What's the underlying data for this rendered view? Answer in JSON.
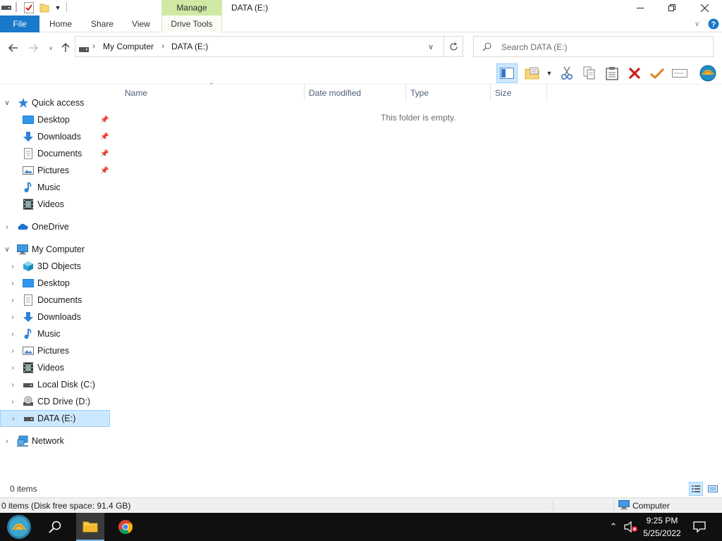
{
  "window": {
    "title": "DATA (E:)",
    "context_tab": "Manage",
    "controls": [
      "minimize",
      "restore",
      "close"
    ]
  },
  "ribbon": {
    "tabs": [
      {
        "label": "File"
      },
      {
        "label": "Home"
      },
      {
        "label": "Share"
      },
      {
        "label": "View"
      },
      {
        "label": "Drive Tools"
      }
    ]
  },
  "address": {
    "crumbs": [
      "My Computer",
      "DATA (E:)"
    ],
    "search_placeholder": "Search DATA (E:)"
  },
  "nav": {
    "quick_access": "Quick access",
    "quick_items": [
      {
        "label": "Desktop",
        "icon": "desktop-icon",
        "pinned": true
      },
      {
        "label": "Downloads",
        "icon": "downloads-icon",
        "pinned": true
      },
      {
        "label": "Documents",
        "icon": "documents-icon",
        "pinned": true
      },
      {
        "label": "Pictures",
        "icon": "pictures-icon",
        "pinned": true
      },
      {
        "label": "Music",
        "icon": "music-icon",
        "pinned": false
      },
      {
        "label": "Videos",
        "icon": "videos-icon",
        "pinned": false
      }
    ],
    "onedrive": "OneDrive",
    "my_computer": "My Computer",
    "computer_items": [
      {
        "label": "3D Objects",
        "icon": "3d-objects-icon"
      },
      {
        "label": "Desktop",
        "icon": "desktop-icon"
      },
      {
        "label": "Documents",
        "icon": "documents-icon"
      },
      {
        "label": "Downloads",
        "icon": "downloads-icon"
      },
      {
        "label": "Music",
        "icon": "music-icon"
      },
      {
        "label": "Pictures",
        "icon": "pictures-icon"
      },
      {
        "label": "Videos",
        "icon": "videos-icon"
      },
      {
        "label": "Local Disk (C:)",
        "icon": "drive-icon"
      },
      {
        "label": "CD Drive (D:)",
        "icon": "cd-drive-icon"
      },
      {
        "label": "DATA (E:)",
        "icon": "drive-icon",
        "selected": true
      }
    ],
    "network": "Network"
  },
  "columns": {
    "name": "Name",
    "date": "Date modified",
    "type": "Type",
    "size": "Size"
  },
  "content": {
    "empty_text": "This folder is empty."
  },
  "status": {
    "items": "0 items",
    "disk": "0 items (Disk free space: 91.4 GB)",
    "location": "Computer"
  },
  "taskbar": {
    "time": "9:25 PM",
    "date": "5/25/2022"
  },
  "colors": {
    "file_tab": "#1979ca",
    "manage_tab": "#cfe9a4",
    "selection": "#cce8ff"
  }
}
